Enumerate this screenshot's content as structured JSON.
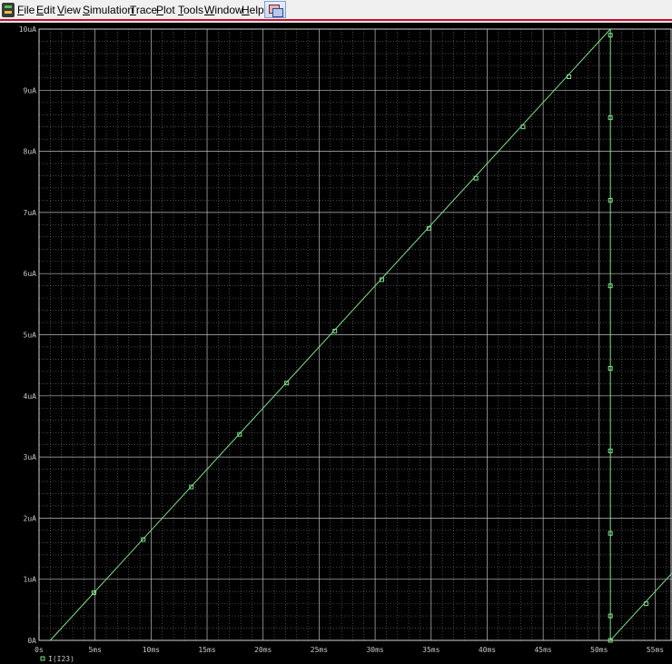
{
  "menu": {
    "items": [
      {
        "first": "F",
        "rest": "ile"
      },
      {
        "first": "E",
        "rest": "dit"
      },
      {
        "first": "V",
        "rest": "iew"
      },
      {
        "first": "S",
        "rest": "imulation"
      },
      {
        "first": "T",
        "rest": "race"
      },
      {
        "first": "P",
        "rest": "lot"
      },
      {
        "first": "T",
        "rest": "ools"
      },
      {
        "first": "W",
        "rest": "indow"
      },
      {
        "first": "H",
        "rest": "elp"
      }
    ],
    "icons": [
      "app-icon",
      "cascade-windows-icon"
    ]
  },
  "colors": {
    "background": "#000000",
    "grid": "#d0d0d0",
    "trace": "#7fe08a",
    "text": "#c8c8c8"
  },
  "chart_data": {
    "type": "line",
    "title": "",
    "xlabel": "",
    "ylabel": "",
    "x_unit": "ms",
    "y_unit": "uA",
    "xlim": [
      0,
      56.5
    ],
    "ylim": [
      0,
      10
    ],
    "x_ticks": [
      "0s",
      "5ms",
      "10ms",
      "15ms",
      "20ms",
      "25ms",
      "30ms",
      "35ms",
      "40ms",
      "45ms",
      "50ms",
      "55ms"
    ],
    "y_ticks": [
      "0A",
      "1uA",
      "2uA",
      "3uA",
      "4uA",
      "5uA",
      "6uA",
      "7uA",
      "8uA",
      "9uA",
      "10uA"
    ],
    "grid": true,
    "legend_position": "bottom-left",
    "series": [
      {
        "name": "I(I23)",
        "x": [
          1.0,
          51.0,
          51.0,
          51.0,
          56.5
        ],
        "y": [
          0.0,
          10.0,
          10.0,
          0.0,
          1.1
        ],
        "markers_x": [
          4.9,
          9.3,
          13.6,
          17.9,
          22.1,
          26.4,
          30.6,
          34.8,
          39.0,
          43.2,
          47.3,
          51.0,
          51.0,
          51.0,
          51.0,
          51.0,
          51.0,
          51.0,
          51.0,
          51.0,
          54.2
        ],
        "markers_y": [
          0.78,
          1.65,
          2.51,
          3.37,
          4.21,
          5.06,
          5.9,
          6.74,
          7.56,
          8.4,
          9.22,
          9.9,
          8.55,
          7.2,
          5.8,
          4.45,
          3.1,
          1.75,
          0.4,
          0.0,
          0.6
        ]
      }
    ]
  }
}
